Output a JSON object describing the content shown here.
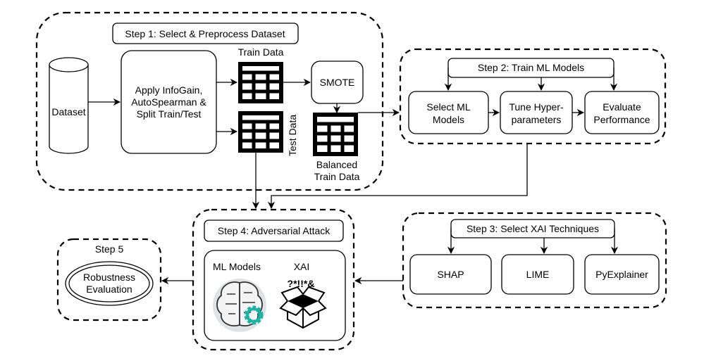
{
  "step1": {
    "label": "Step 1: Select & Preprocess Dataset",
    "dataset": "Dataset",
    "apply": [
      "Apply InfoGain,",
      "AutoSpearman &",
      "Split Train/Test"
    ],
    "train_data": "Train Data",
    "test_data": "Test Data",
    "smote": "SMOTE",
    "balanced": [
      "Balanced",
      "Train Data"
    ]
  },
  "step2": {
    "label": "Step 2: Train ML Models",
    "boxes": [
      [
        "Select ML",
        "Models"
      ],
      [
        "Tune Hyper-",
        "parameters"
      ],
      [
        "Evaluate",
        "Performance"
      ]
    ]
  },
  "step3": {
    "label": "Step 3: Select XAI Techniques",
    "boxes": [
      "SHAP",
      "LIME",
      "PyExplainer"
    ]
  },
  "step4": {
    "label": "Step 4: Adversarial Attack",
    "ml_models": "ML Models",
    "xai": "XAI",
    "xai_symbols": "?*!!*&"
  },
  "step5": {
    "label": "Step 5",
    "evaluation": [
      "Robustness",
      "Evaluation"
    ]
  },
  "colors": {
    "gear": "#1ab3a6",
    "brain_bg": "#dfe3e6"
  }
}
